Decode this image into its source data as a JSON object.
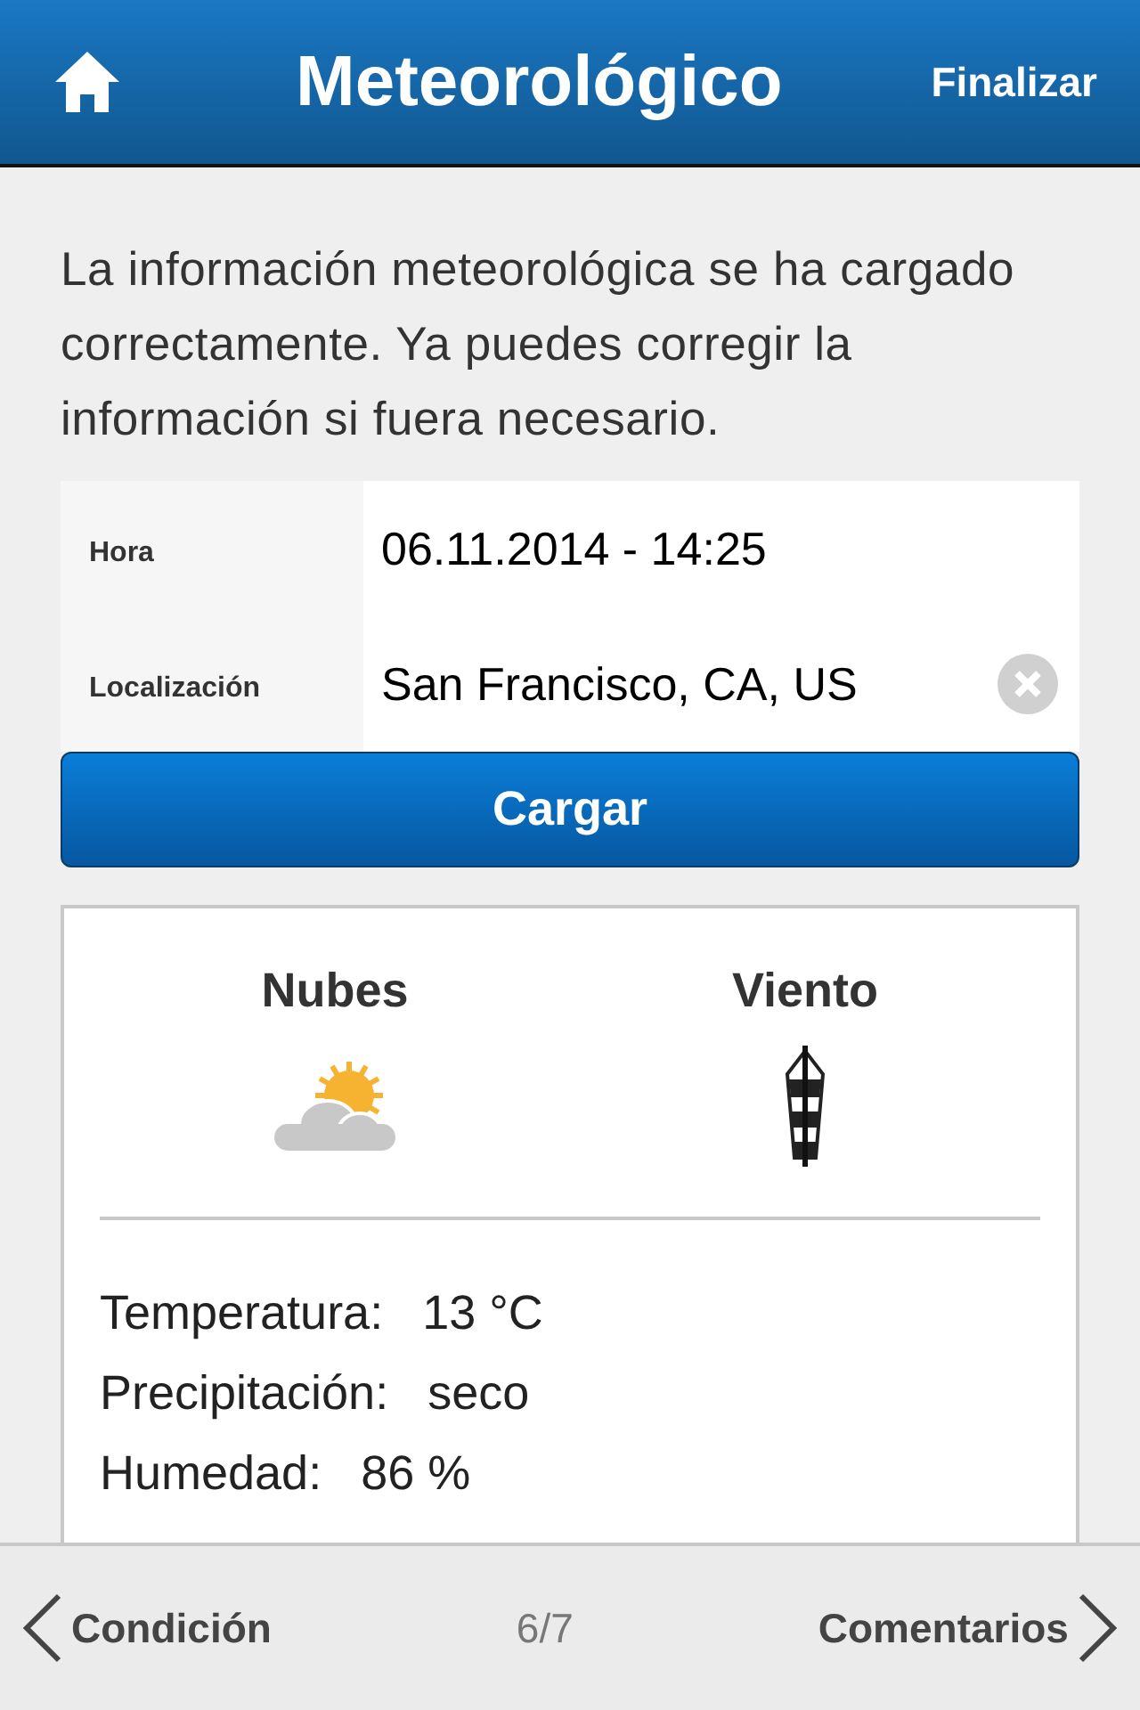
{
  "header": {
    "title": "Meteorológico",
    "action": "Finalizar"
  },
  "intro": "La información meteorológica se ha cargado correctamente. Ya puedes corregir la información si fuera necesario.",
  "form": [
    {
      "label": "Hora",
      "value": "06.11.2014 - 14:25",
      "clearable": false
    },
    {
      "label": "Localización",
      "value": "San Francisco, CA, US",
      "clearable": true
    }
  ],
  "load_button": "Cargar",
  "conditions": [
    {
      "title": "Nubes",
      "kind": "clouds"
    },
    {
      "title": "Viento",
      "kind": "wind"
    }
  ],
  "readings": [
    {
      "label": "Temperatura:",
      "value": "13 °C"
    },
    {
      "label": "Precipitación:",
      "value": "seco"
    },
    {
      "label": "Humedad:",
      "value": "86 %"
    }
  ],
  "footer": {
    "previous": "Condición",
    "page": "6/7",
    "next": "Comentarios"
  }
}
